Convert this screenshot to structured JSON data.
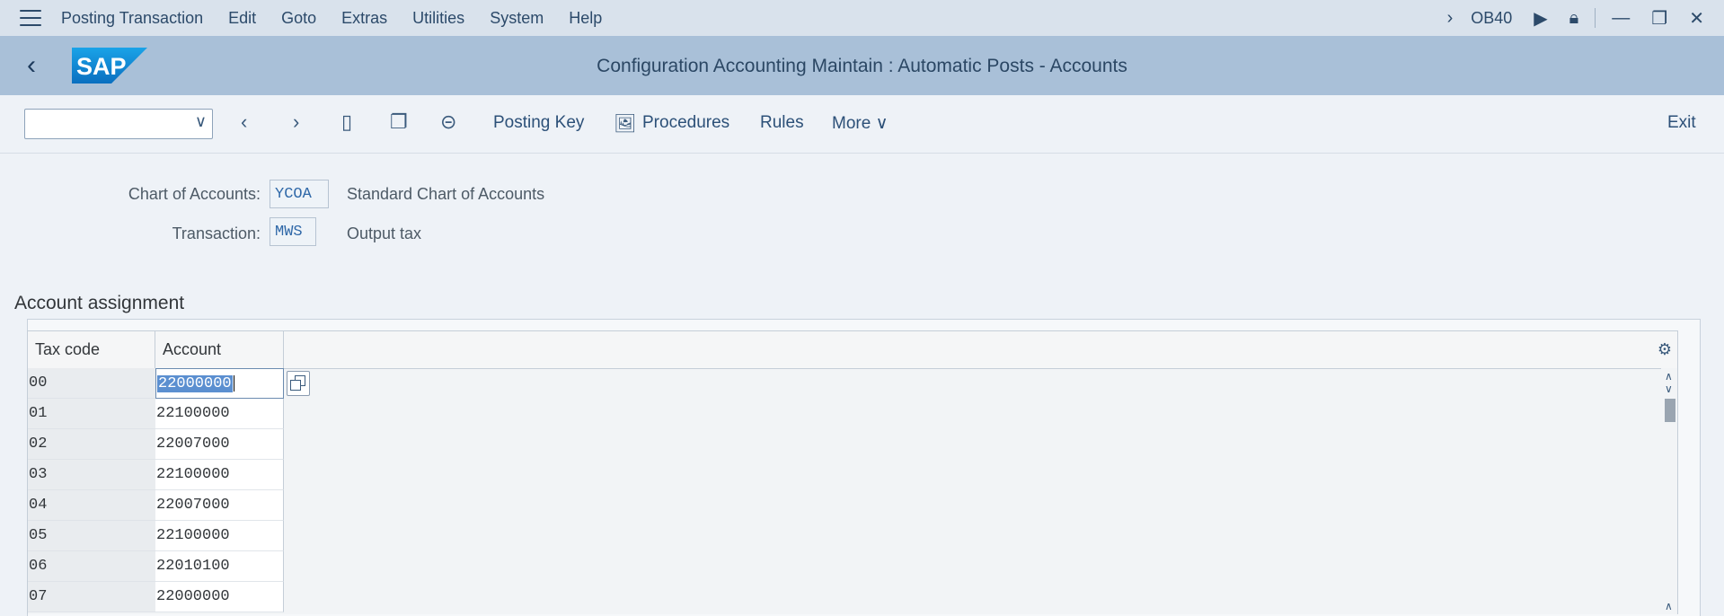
{
  "menubar": {
    "items": [
      "Posting Transaction",
      "Edit",
      "Goto",
      "Extras",
      "Utilities",
      "System",
      "Help"
    ],
    "tcode": "OB40"
  },
  "shell": {
    "title": "Configuration Accounting Maintain : Automatic Posts - Accounts",
    "logo_text": "SAP"
  },
  "toolbar": {
    "command_field_value": "",
    "posting_key_label": "Posting Key",
    "procedures_label": "Procedures",
    "rules_label": "Rules",
    "more_label": "More",
    "exit_label": "Exit"
  },
  "header": {
    "chart_label": "Chart of Accounts:",
    "chart_value": "YCOA",
    "chart_desc": "Standard Chart of Accounts",
    "transaction_label": "Transaction:",
    "transaction_value": "MWS",
    "transaction_desc": "Output tax"
  },
  "section": {
    "title": "Account assignment"
  },
  "table": {
    "columns": [
      "Tax code",
      "Account"
    ],
    "rows": [
      {
        "tax": "00",
        "account": "22000000"
      },
      {
        "tax": "01",
        "account": "22100000"
      },
      {
        "tax": "02",
        "account": "22007000"
      },
      {
        "tax": "03",
        "account": "22100000"
      },
      {
        "tax": "04",
        "account": "22007000"
      },
      {
        "tax": "05",
        "account": "22100000"
      },
      {
        "tax": "06",
        "account": "22010100"
      },
      {
        "tax": "07",
        "account": "22000000"
      }
    ]
  },
  "colors": {
    "shell": "#a9c0d8",
    "menubar": "#d9e2ec",
    "selection": "#5b8fd0"
  }
}
